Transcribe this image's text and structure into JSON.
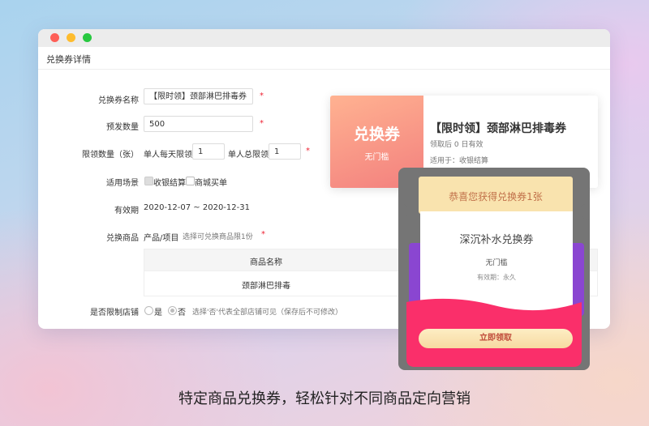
{
  "window": {
    "page_title": "兑换券详情"
  },
  "form": {
    "name": {
      "label": "兑换券名称",
      "value": "【限时领】颈部淋巴排毒券"
    },
    "quantity": {
      "label": "预发数量",
      "value": "500"
    },
    "limit": {
      "label": "限领数量（张）",
      "daily_label": "单人每天限领",
      "daily_value": "1",
      "total_label": "单人总限领",
      "total_value": "1"
    },
    "scene": {
      "label": "适用场景",
      "options": [
        "收银结算",
        "商城买单"
      ]
    },
    "validity": {
      "label": "有效期",
      "value": "2020-12-07 ~ 2020-12-31"
    },
    "goods": {
      "label": "兑换商品",
      "type": "产品/项目",
      "hint": "选择可兑换商品限1份"
    },
    "table": {
      "header": "商品名称",
      "rows": [
        "颈部淋巴排毒"
      ]
    },
    "store_limit": {
      "label": "是否限制店铺",
      "yes": "是",
      "no": "否",
      "hint": "选择'否'代表全部店铺可见（保存后不可修改）"
    },
    "required_mark": "*"
  },
  "card": {
    "left_title": "兑换券",
    "left_sub": "无门槛",
    "title": "【限时领】颈部淋巴排毒券",
    "valid": "领取后 0 日有效",
    "scope": "适用于：收银结算"
  },
  "phone": {
    "banner": "恭喜您获得兑换券1张",
    "coupon_name": "深沉补水兑换券",
    "threshold": "无门槛",
    "validity": "有效期：永久",
    "claim_button": "立即领取"
  },
  "caption": "特定商品兑换券，轻松针对不同商品定向营销",
  "colors": {
    "accent_red": "#e23333",
    "coupon_gradient_start": "#ffb291",
    "coupon_gradient_end": "#f3807e",
    "phone_pink": "#fa2f6a",
    "phone_purple": "#8a46d1"
  }
}
